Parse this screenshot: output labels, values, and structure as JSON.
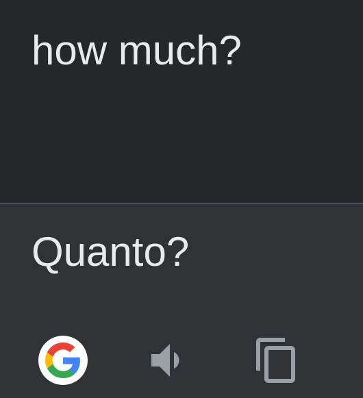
{
  "source": {
    "text": "how much?"
  },
  "translation": {
    "text": "Quanto?"
  },
  "actions": {
    "google_icon": "google-g-icon",
    "speaker_icon": "speaker-icon",
    "copy_icon": "copy-icon"
  },
  "colors": {
    "source_background": "#25282a",
    "target_background": "#303236",
    "divider": "#4a4d52",
    "text": "#e8eaed",
    "icon_gray": "#9aa0a6",
    "google_blue": "#4285F4",
    "google_red": "#EA4335",
    "google_yellow": "#FBBC05",
    "google_green": "#34A853"
  }
}
